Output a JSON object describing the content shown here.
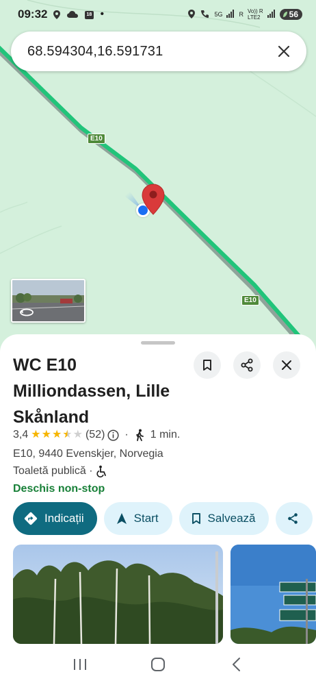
{
  "status_bar": {
    "time": "09:32",
    "notification_badge": "18",
    "network_1": "5G",
    "network_2": "R",
    "network_3": "Vo)) R",
    "network_4": "LTE2",
    "battery": "56"
  },
  "search": {
    "query": "68.594304,16.591731"
  },
  "map": {
    "road_label_1": "E10",
    "road_label_2": "E10",
    "colors": {
      "land": "#d4f0dc",
      "road_traffic": "#21c47a",
      "pin": "#d93a3a",
      "my_location": "#1a6ef3"
    }
  },
  "place": {
    "title": "WC E10 Milliondassen, Lille Skånland",
    "rating": "3,4",
    "rating_value": 3.4,
    "review_count": "(52)",
    "separator": "·",
    "walk_time": "1 min.",
    "address": "E10, 9440 Evenskjer, Norvegia",
    "category": "Toaletă publică ·",
    "hours": "Deschis non-stop"
  },
  "actions": {
    "directions": "Indicații",
    "start": "Start",
    "save": "Salvează"
  },
  "icons": {
    "search_clear": "close-icon",
    "save": "bookmark-icon",
    "share": "share-icon",
    "close": "close-icon",
    "info": "info-icon",
    "walk": "walking-icon",
    "accessible": "wheelchair-icon",
    "directions": "directions-icon",
    "start": "navigation-arrow-icon"
  }
}
